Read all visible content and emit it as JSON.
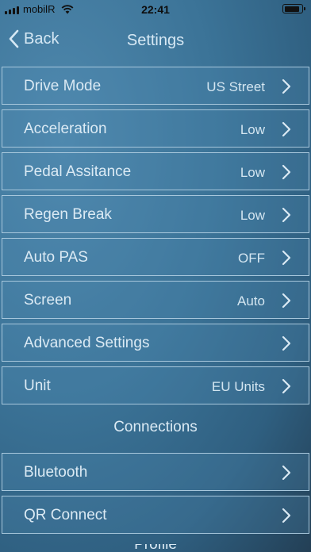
{
  "status_bar": {
    "carrier": "mobilR",
    "time": "22:41"
  },
  "nav": {
    "back_label": "Back",
    "title": "Settings"
  },
  "settings_rows": [
    {
      "label": "Drive Mode",
      "value": "US Street"
    },
    {
      "label": "Acceleration",
      "value": "Low"
    },
    {
      "label": "Pedal Assitance",
      "value": "Low"
    },
    {
      "label": "Regen Break",
      "value": "Low"
    },
    {
      "label": "Auto PAS",
      "value": "OFF"
    },
    {
      "label": "Screen",
      "value": "Auto"
    },
    {
      "label": "Advanced Settings",
      "value": ""
    },
    {
      "label": "Unit",
      "value": "EU Units"
    }
  ],
  "connections": {
    "header": "Connections",
    "rows": [
      {
        "label": "Bluetooth"
      },
      {
        "label": "QR Connect"
      }
    ]
  },
  "next_section_header": "Profile",
  "colors": {
    "text": "#dbeaf4",
    "row_border": "#a7c7dc",
    "background": "#3b7397"
  }
}
